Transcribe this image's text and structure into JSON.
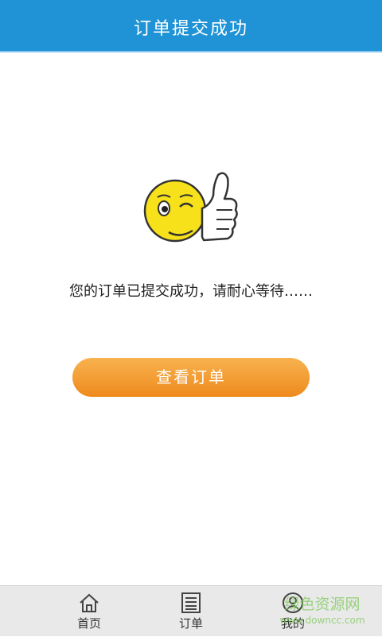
{
  "header": {
    "title": "订单提交成功"
  },
  "main": {
    "emoji_icon": "thumbs-up-winking-smiley",
    "message": "您的订单已提交成功，请耐心等待……",
    "view_order_label": "查看订单"
  },
  "tabbar": {
    "items": [
      {
        "label": "首页",
        "icon": "home-icon"
      },
      {
        "label": "订单",
        "icon": "order-list-icon"
      },
      {
        "label": "我的",
        "icon": "profile-icon"
      }
    ]
  },
  "watermark": {
    "line1": "绿色资源网",
    "line2": "www.downcc.com"
  },
  "colors": {
    "header": "#1f93d6",
    "button": "#f29a2e",
    "tabbar": "#e9e9e9"
  }
}
